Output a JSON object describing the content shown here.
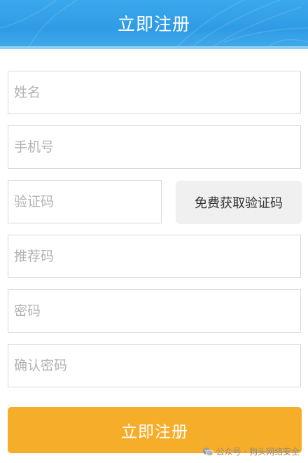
{
  "header": {
    "title": "立即注册"
  },
  "form": {
    "name_placeholder": "姓名",
    "phone_placeholder": "手机号",
    "code_placeholder": "验证码",
    "get_code_label": "免费获取验证码",
    "referral_placeholder": "推荐码",
    "password_placeholder": "密码",
    "confirm_password_placeholder": "确认密码",
    "submit_label": "立即注册"
  },
  "watermark": {
    "text": "公众号 · 狗头网络安全"
  },
  "colors": {
    "header": "#3aa8ec",
    "submit": "#f6ad29",
    "code_button": "#f0f0f0",
    "border": "#d9d9d9"
  },
  "icons": {
    "watermark_icon": "wechat-icon"
  }
}
